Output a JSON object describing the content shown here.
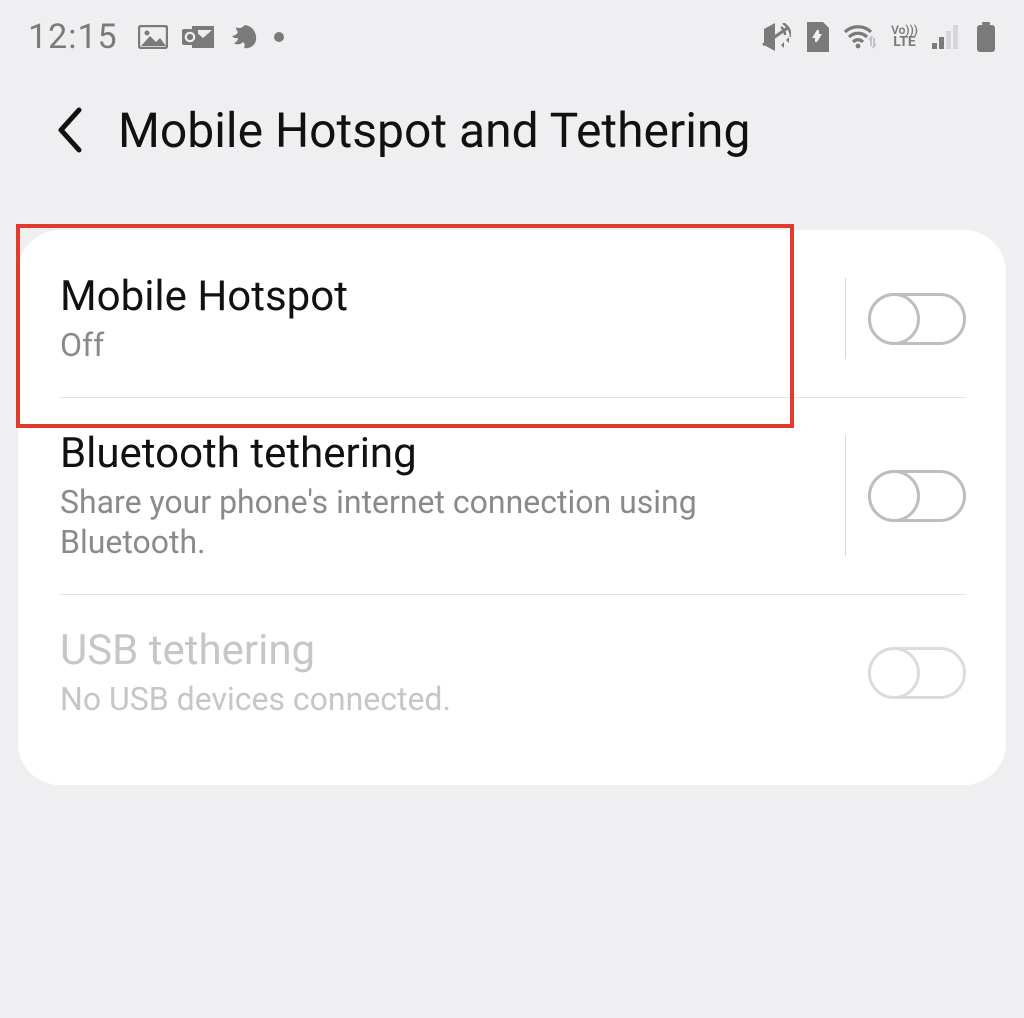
{
  "statusbar": {
    "time": "12:15"
  },
  "header": {
    "title": "Mobile Hotspot and Tethering"
  },
  "items": [
    {
      "title": "Mobile Hotspot",
      "subtitle": "Off",
      "toggle": false,
      "disabled": false,
      "highlighted": true
    },
    {
      "title": "Bluetooth tethering",
      "subtitle": "Share your phone's internet connection using Bluetooth.",
      "toggle": false,
      "disabled": false,
      "highlighted": false
    },
    {
      "title": "USB tethering",
      "subtitle": "No USB devices connected.",
      "toggle": false,
      "disabled": true,
      "highlighted": false
    }
  ]
}
